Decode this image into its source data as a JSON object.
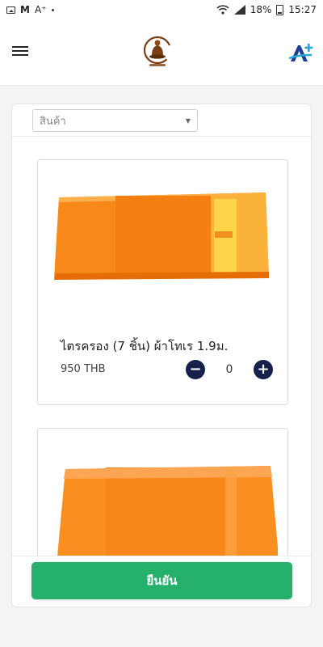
{
  "status_bar": {
    "text_icon": "A⁺",
    "battery_percent": "18%",
    "time": "15:27",
    "icons": [
      "image-icon",
      "gmail-icon",
      "font-icon",
      "dot-icon",
      "wifi-icon",
      "signal-icon",
      "battery-icon"
    ]
  },
  "header": {
    "icons": [
      "menu-icon",
      "temple-logo",
      "font-size-icon"
    ],
    "colors": {
      "background": "#ffffff",
      "page_background": "#f4f4f4"
    }
  },
  "filter": {
    "selected": "สินค้า"
  },
  "products": [
    {
      "name": "ไตรครอง (7 ชิ้น) ผ้าโทเร 1.9ม.",
      "price": "950 THB",
      "quantity": "0",
      "color": "#f98d1e"
    },
    {
      "color": "#fa8f21"
    }
  ],
  "qty_controls": {
    "minus": "−",
    "plus": "+"
  },
  "confirm": {
    "label": "ยืนยัน",
    "color": "#25b06c"
  }
}
